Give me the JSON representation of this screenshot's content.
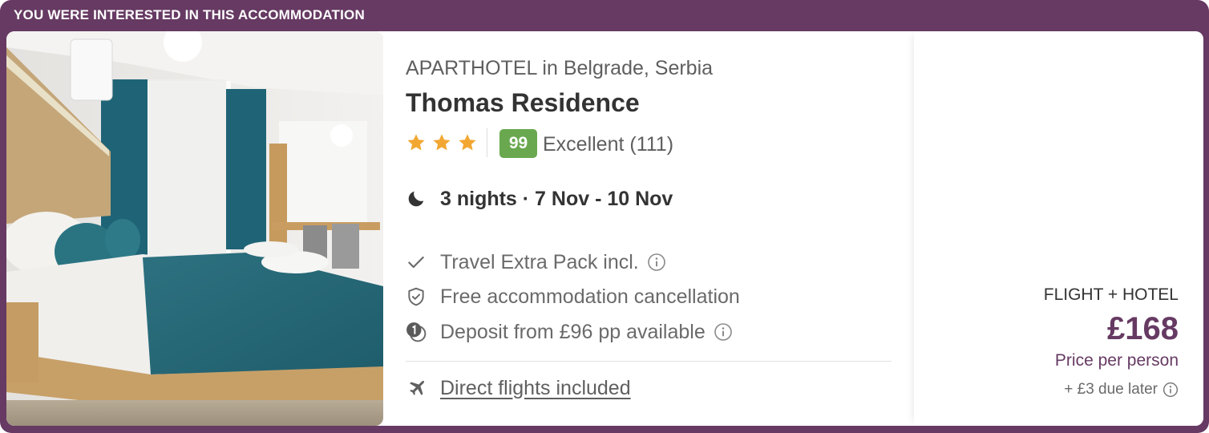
{
  "banner": "YOU WERE INTERESTED IN THIS ACCOMMODATION",
  "hotel": {
    "subtitle": "APARTHOTEL in Belgrade, Serbia",
    "name": "Thomas Residence",
    "stars": 3,
    "score": "99",
    "rating_text": "Excellent (111)",
    "dates": "3 nights · 7 Nov - 10 Nov"
  },
  "features": [
    {
      "icon": "check-icon",
      "text": "Travel Extra Pack incl."
    },
    {
      "icon": "shield-check-icon",
      "text": "Free accommodation cancellation"
    },
    {
      "icon": "deposit-coins-icon",
      "text": "Deposit from £96 pp available"
    }
  ],
  "flights_link": "Direct flights included",
  "price": {
    "package": "FLIGHT + HOTEL",
    "amount": "£168",
    "per_person": "Price per person",
    "due_later": "+ £3 due later"
  },
  "colors": {
    "brand": "#663a63",
    "score_badge": "#69a84f",
    "star": "#f2a732"
  }
}
